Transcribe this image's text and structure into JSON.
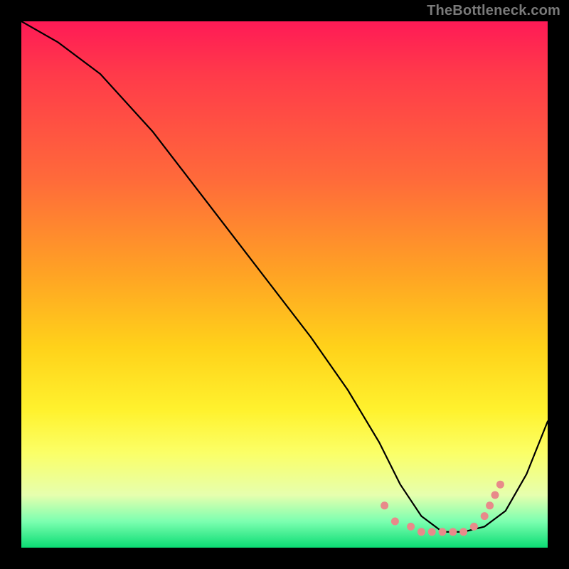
{
  "watermark": "TheBottleneck.com",
  "chart_data": {
    "type": "line",
    "title": "",
    "xlabel": "",
    "ylabel": "",
    "xlim": [
      0,
      100
    ],
    "ylim": [
      0,
      100
    ],
    "series": [
      {
        "name": "curve",
        "x": [
          0,
          7,
          15,
          25,
          35,
          45,
          55,
          62,
          68,
          72,
          76,
          80,
          84,
          88,
          92,
          96,
          100
        ],
        "y": [
          100,
          96,
          90,
          79,
          66,
          53,
          40,
          30,
          20,
          12,
          6,
          3,
          3,
          4,
          7,
          14,
          24
        ]
      }
    ],
    "markers": {
      "name": "dots",
      "color": "#e88a8a",
      "x": [
        69,
        71,
        74,
        76,
        78,
        80,
        82,
        84,
        86,
        88,
        89,
        90,
        91
      ],
      "y": [
        8,
        5,
        4,
        3,
        3,
        3,
        3,
        3,
        4,
        6,
        8,
        10,
        12
      ]
    },
    "gradient_stops": [
      {
        "pos": 0,
        "color": "#ff1a56"
      },
      {
        "pos": 10,
        "color": "#ff3a4a"
      },
      {
        "pos": 30,
        "color": "#ff6a3a"
      },
      {
        "pos": 48,
        "color": "#ffa324"
      },
      {
        "pos": 62,
        "color": "#ffd21a"
      },
      {
        "pos": 74,
        "color": "#fff22e"
      },
      {
        "pos": 82,
        "color": "#fbff67"
      },
      {
        "pos": 90,
        "color": "#e6ffae"
      },
      {
        "pos": 95,
        "color": "#7cffb0"
      },
      {
        "pos": 100,
        "color": "#0bdc74"
      }
    ]
  }
}
